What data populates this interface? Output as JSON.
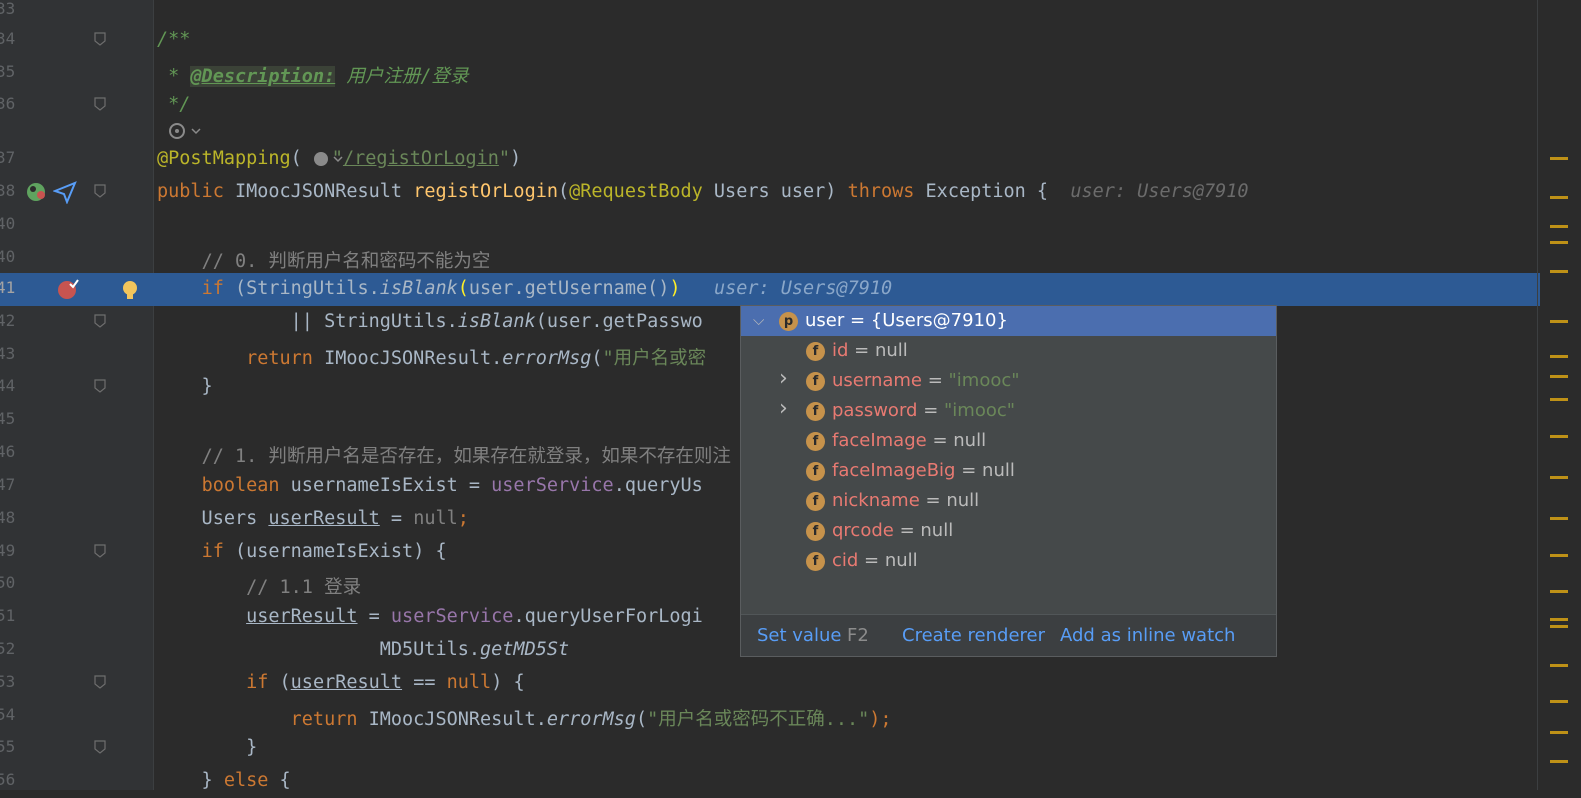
{
  "editor": {
    "lines": [
      {
        "num": "33",
        "html": ""
      },
      {
        "num": "34",
        "html": "<span class='doc'>/**</span>"
      },
      {
        "num": "35",
        "html": "<span class='doc'> * </span><span class='doctag'>@Description:</span><span class='doc'> 用户注册/登录</span>"
      },
      {
        "num": "36",
        "html": "<span class='doc'> */</span>"
      },
      {
        "num": "",
        "html": ""
      },
      {
        "num": "37",
        "html": "<span class='ann'>@PostMapping</span>(<span style='display:inline-block;width:30px'></span><span class='str'>\"</span><span class='str und'>/registOrLogin</span><span class='str'>\"</span>)"
      },
      {
        "num": "38",
        "html": "<span class='kw'>public</span> IMoocJSONResult <span class='fn'>registOrLogin</span>(<span class='ann'>@RequestBody</span> Users user) <span class='kw'>throws</span> Exception {  <span class='inl'>user: Users@7910</span>"
      },
      {
        "num": "40",
        "html": ""
      },
      {
        "num": "40",
        "html": "    <span class='cm'>// 0. 判断用户名和密码不能为空</span>"
      },
      {
        "num": "41",
        "html": "    <span class='kw'>if</span> (StringUtils.<span class='it'>isBlank</span><span style='color:#ffef28'>(</span>user.getUsername()<span style='color:#ffef28'>)</span>   <span class='inl'>user: Users@7910</span>"
      },
      {
        "num": "42",
        "html": "            || StringUtils.<span class='it'>isBlank</span>(user.getPasswo"
      },
      {
        "num": "43",
        "html": "        <span class='kw'>return</span> IMoocJSONResult.<span class='it'>errorMsg</span>(<span class='str'>\"用户名或密</span>"
      },
      {
        "num": "44",
        "html": "    }"
      },
      {
        "num": "45",
        "html": ""
      },
      {
        "num": "46",
        "html": "    <span class='cm'>// 1. 判断用户名是否存在，如果存在就登录，如果不存在则注</span>"
      },
      {
        "num": "47",
        "html": "    <span class='kw'>boolean</span> usernameIsExist = <span class='fld'>userService</span>.queryUs"
      },
      {
        "num": "48",
        "html": "    Users <span class='und'>userResult</span> = <span class='kw' style='color:#808080'>null</span><span class='kw'>;</span>"
      },
      {
        "num": "49",
        "html": "    <span class='kw'>if</span> (usernameIsExist) {"
      },
      {
        "num": "50",
        "html": "        <span class='cm'>// 1.1 登录</span>"
      },
      {
        "num": "51",
        "html": "        <span class='und'>userResult</span> = <span class='fld'>userService</span>.queryUserForLogi"
      },
      {
        "num": "52",
        "html": "                    MD5Utils.<span class='it'>getMD5St</span>"
      },
      {
        "num": "53",
        "html": "        <span class='kw'>if</span> (<span class='und'>userResult</span> == <span class='kw'>null</span>) {"
      },
      {
        "num": "54",
        "html": "            <span class='kw'>return</span> IMoocJSONResult.<span class='it'>errorMsg</span>(<span class='str'>\"用户名或密码不正确...\"</span><span class='kw'>);</span>"
      },
      {
        "num": "55",
        "html": "        }"
      },
      {
        "num": "56",
        "html": "    } <span class='kw'>else</span> {"
      }
    ]
  },
  "debug_popup": {
    "root": {
      "name": "user",
      "value": "{Users@7910}",
      "badge": "p"
    },
    "fields": [
      {
        "name": "id",
        "eq": " = ",
        "value": "null",
        "is_str": false,
        "expandable": false,
        "badge": "f"
      },
      {
        "name": "username",
        "eq": " = ",
        "value": "\"imooc\"",
        "is_str": true,
        "expandable": true,
        "badge": "f"
      },
      {
        "name": "password",
        "eq": " = ",
        "value": "\"imooc\"",
        "is_str": true,
        "expandable": true,
        "badge": "f"
      },
      {
        "name": "faceImage",
        "eq": " = ",
        "value": "null",
        "is_str": false,
        "expandable": false,
        "badge": "f"
      },
      {
        "name": "faceImageBig",
        "eq": " = ",
        "value": "null",
        "is_str": false,
        "expandable": false,
        "badge": "f"
      },
      {
        "name": "nickname",
        "eq": " = ",
        "value": "null",
        "is_str": false,
        "expandable": false,
        "badge": "f"
      },
      {
        "name": "qrcode",
        "eq": " = ",
        "value": "null",
        "is_str": false,
        "expandable": false,
        "badge": "f"
      },
      {
        "name": "cid",
        "eq": " = ",
        "value": "null",
        "is_str": false,
        "expandable": false,
        "badge": "f"
      }
    ],
    "footer": {
      "set_value": "Set value",
      "set_value_key": "F2",
      "create_renderer": "Create renderer",
      "add_inline_watch": "Add as inline watch"
    }
  },
  "colors": {
    "background": "#2b2b2b",
    "current_line": "#2d5a94",
    "popup_selection": "#4b6eaf",
    "marker": "#be9117"
  }
}
